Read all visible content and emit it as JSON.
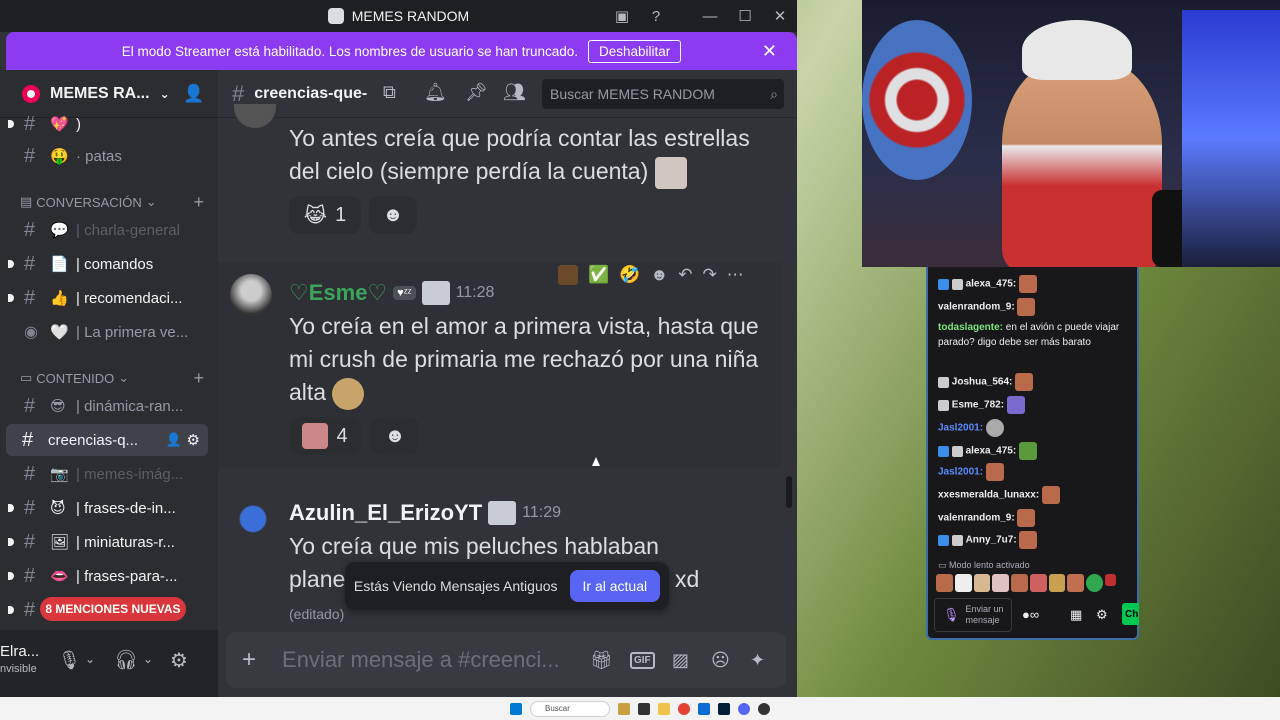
{
  "window": {
    "title": "MEMES RANDOM"
  },
  "banner": {
    "text": "El modo Streamer está habilitado. Los nombres de usuario se han truncado.",
    "button": "Deshabilitar"
  },
  "server": {
    "name": "MEMES RA..."
  },
  "channel": {
    "name": "creencias-que-",
    "search_placeholder": "Buscar MEMES RANDOM"
  },
  "sidebar": {
    "channels_top": [
      {
        "emoji": "💖",
        "label": ")"
      },
      {
        "emoji": "🤑",
        "label": "· patas"
      }
    ],
    "cat_conversacion": "CONVERSACIÓN",
    "conv_channels": [
      {
        "emoji": "💬",
        "label": "| charla-general"
      },
      {
        "emoji": "📄",
        "label": "| comandos"
      },
      {
        "emoji": "👍",
        "label": "| recomendaci..."
      },
      {
        "emoji": "🤍",
        "label": "| La primera ve..."
      }
    ],
    "cat_contenido": "CONTENIDO",
    "cont_channels": [
      {
        "emoji": "😎",
        "label": "| dinámica-ran..."
      },
      {
        "emoji": "",
        "label": "creencias-q..."
      },
      {
        "emoji": "📷",
        "label": "| memes-imág..."
      },
      {
        "emoji": "😈",
        "label": "| frases-de-in..."
      },
      {
        "emoji": "🖼",
        "label": "| miniaturas-r..."
      },
      {
        "emoji": "👄",
        "label": "| frases-para-..."
      }
    ],
    "mentions": "8 MENCIONES NUEVAS",
    "user_name": "Elra...",
    "user_status": "nvisible"
  },
  "messages": [
    {
      "text": "Yo antes creía que podría contar las estrellas del cielo (siempre perdía la cuenta)",
      "reaction_count": "1"
    },
    {
      "author": "♡Esme♡",
      "badge": "♥ᶻᶻ",
      "time": "11:28",
      "text": "Yo creía en el amor a primera vista, hasta que mi crush de primaria me rechazó por una niña alta",
      "reaction_count": "4"
    },
    {
      "author": "Azulin_El_ErizoYT",
      "time": "11:29",
      "text_line1": "Yo creía que mis peluches hablaban",
      "text_line2_start": "plane",
      "text_line2_end": "xd",
      "edited": "(editado)"
    }
  ],
  "old_messages": {
    "text": "Estás Viendo Mensajes Antiguos",
    "button": "Ir al actual"
  },
  "composer": {
    "placeholder": "Enviar mensaje a #creenci..."
  },
  "twitch_chat": {
    "lines": [
      {
        "user": "alexa_475:",
        "msg": "",
        "color": "#ffffff"
      },
      {
        "user": "valenrandom_9:",
        "msg": "",
        "color": "#ffffff"
      },
      {
        "user": "todaslagente:",
        "msg": "en el avión c puede viajar parado? digo debe ser más barato",
        "color": "#7be67b"
      },
      {
        "user": "Joshua_564:",
        "msg": "",
        "color": "#ffffff"
      },
      {
        "user": "Esme_782:",
        "msg": "",
        "color": "#ffffff"
      },
      {
        "user": "Jasl2001:",
        "msg": "",
        "color": "#5b8cff"
      },
      {
        "user": "alexa_475:",
        "msg": "",
        "color": "#ffffff"
      },
      {
        "user": "Jasl2001:",
        "msg": "",
        "color": "#5b8cff"
      },
      {
        "user": "xxesmeralda_lunaxx:",
        "msg": "",
        "color": "#ffffff"
      },
      {
        "user": "valenrandom_9:",
        "msg": "",
        "color": "#ffffff"
      },
      {
        "user": "Anny_7u7:",
        "msg": "",
        "color": "#ffffff"
      }
    ],
    "slow_mode": "Modo lento activado",
    "input_placeholder": "Enviar un mensaje",
    "chat_button": "Ch"
  },
  "taskbar": {
    "search": "Buscar"
  },
  "colors": {
    "accent": "#5865f2",
    "streamer_banner": "#8c3bf0",
    "esme": "#3ba55c"
  }
}
